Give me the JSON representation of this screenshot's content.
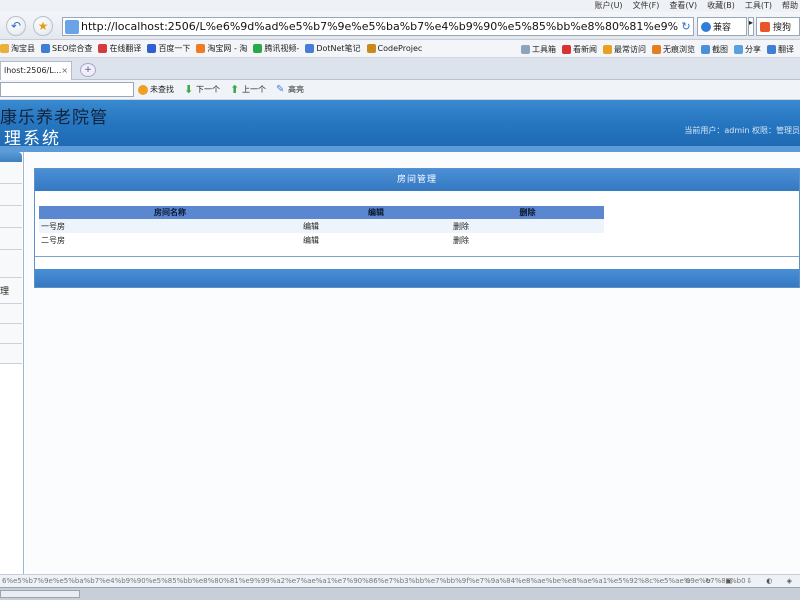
{
  "browser": {
    "menus": [
      "账户(U)",
      "文件(F)",
      "查看(V)",
      "收藏(B)",
      "工具(T)",
      "帮助"
    ],
    "url": "http://localhost:2506/L%e6%9d%ad%e5%b7%9e%e5%ba%b7%e4%b9%90%e5%85%bb%e8%80%81%e9%99%a2%e7%ae%",
    "compat_label": "兼容",
    "search_label": "搜狗",
    "favorites": [
      "淘宝县",
      "SEO综合查",
      "在线翻译",
      "百度一下",
      "淘宝网 - 淘",
      "腾讯视频-",
      "DotNet笔记",
      "CodeProjec"
    ],
    "favorites_right": [
      "工具箱",
      "看新闻",
      "最常访问",
      "无痕浏览",
      "截图",
      "分享",
      "翻译"
    ],
    "tab_title": "lhost:2506/L...",
    "tab_close": "×",
    "new_tab": "+",
    "find_buttons": [
      "未查找",
      "下一个",
      "上一个",
      "高亮"
    ]
  },
  "app": {
    "title_line1": "康乐养老院管",
    "title_line2": "理系统",
    "user_info": "当前用户：admin    权限：管理员"
  },
  "panel": {
    "title": "房间管理",
    "columns": [
      "房间名称",
      "编辑",
      "删除"
    ],
    "rows": [
      [
        "一号房",
        "编辑",
        "删除"
      ],
      [
        "二号房",
        "编辑",
        "删除"
      ]
    ]
  },
  "left_panel": {
    "item": "理"
  },
  "status": {
    "text": "6%e5%b7%9e%e5%ba%b7%e4%b9%90%e5%85%bb%e8%80%81%e9%99%a2%e7%ae%a1%e7%90%86%e7%b3%bb%e7%bb%9f%e7%9a%84%e8%ae%be%e8%ae%a1%e5%92%8c%e5%ae%9e%e7%8e%b0",
    "icons": "⊙ ↻ ▣ ⇩ ◐ ◈"
  }
}
